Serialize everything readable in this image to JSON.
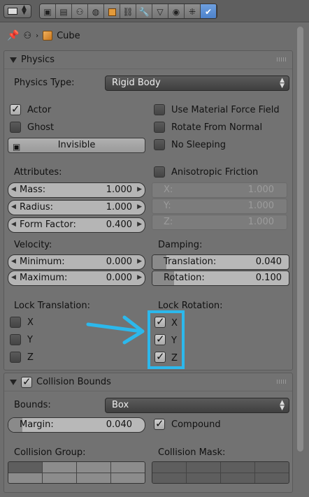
{
  "breadcrumb": {
    "object_name": "Cube"
  },
  "properties_tabs": [
    {
      "icon": "render-icon"
    },
    {
      "icon": "render-layers-icon"
    },
    {
      "icon": "scene-icon"
    },
    {
      "icon": "world-icon"
    },
    {
      "icon": "object-icon"
    },
    {
      "icon": "constraints-icon"
    },
    {
      "icon": "modifiers-icon"
    },
    {
      "icon": "data-icon"
    },
    {
      "icon": "material-icon"
    },
    {
      "icon": "particles-icon"
    },
    {
      "icon": "physics-icon"
    }
  ],
  "physics": {
    "title": "Physics",
    "type_label": "Physics Type:",
    "type_value": "Rigid Body",
    "actor": {
      "label": "Actor",
      "checked": true
    },
    "ghost": {
      "label": "Ghost",
      "checked": false
    },
    "invisible_label": "Invisible",
    "use_material_force_field": {
      "label": "Use Material Force Field",
      "checked": false
    },
    "rotate_from_normal": {
      "label": "Rotate From Normal",
      "checked": false
    },
    "no_sleeping": {
      "label": "No Sleeping",
      "checked": false
    },
    "attributes_label": "Attributes:",
    "mass": {
      "label": "Mass:",
      "value": "1.000"
    },
    "radius": {
      "label": "Radius:",
      "value": "1.000"
    },
    "form_factor": {
      "label": "Form Factor:",
      "value": "0.400"
    },
    "anisotropic_friction": {
      "label": "Anisotropic Friction",
      "checked": false
    },
    "aniso_x": {
      "label": "X:",
      "value": "1.000"
    },
    "aniso_y": {
      "label": "Y:",
      "value": "1.000"
    },
    "aniso_z": {
      "label": "Z:",
      "value": "1.000"
    },
    "velocity_label": "Velocity:",
    "vel_min": {
      "label": "Minimum:",
      "value": "0.000"
    },
    "vel_max": {
      "label": "Maximum:",
      "value": "0.000"
    },
    "damping_label": "Damping:",
    "damp_translation": {
      "label": "Translation:",
      "value": "0.040",
      "fraction": 0.04
    },
    "damp_rotation": {
      "label": "Rotation:",
      "value": "0.100",
      "fraction": 0.1
    },
    "lock_translation_label": "Lock Translation:",
    "lock_trans_x": {
      "label": "X",
      "checked": false
    },
    "lock_trans_y": {
      "label": "Y",
      "checked": false
    },
    "lock_trans_z": {
      "label": "Z",
      "checked": false
    },
    "lock_rotation_label": "Lock Rotation:",
    "lock_rot_x": {
      "label": "X",
      "checked": true
    },
    "lock_rot_y": {
      "label": "Y",
      "checked": true
    },
    "lock_rot_z": {
      "label": "Z",
      "checked": true
    }
  },
  "collision": {
    "title": "Collision Bounds",
    "enabled": true,
    "bounds_label": "Bounds:",
    "bounds_value": "Box",
    "margin": {
      "label": "Margin:",
      "value": "0.040",
      "fraction": 0.04
    },
    "compound": {
      "label": "Compound",
      "checked": true
    },
    "group_label": "Collision Group:",
    "mask_label": "Collision Mask:"
  },
  "annotation": {
    "color": "#2cb8ec"
  }
}
